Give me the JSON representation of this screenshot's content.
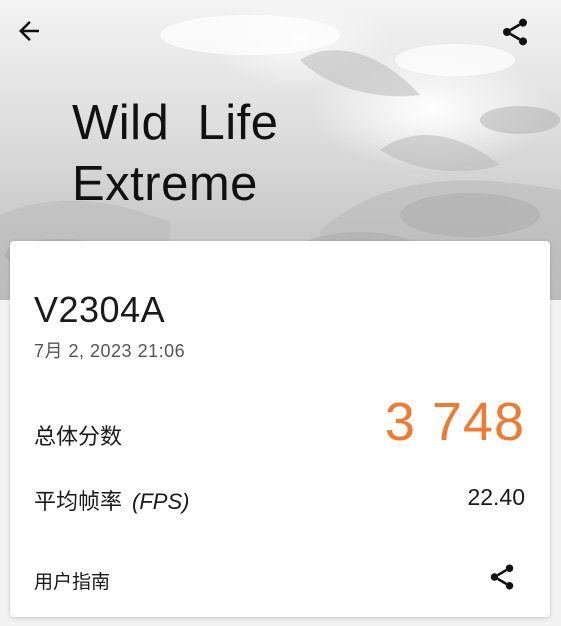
{
  "header": {
    "title": "Wild  Life\nExtreme",
    "back_icon": "arrow-left-icon",
    "share_icon": "share-icon"
  },
  "result": {
    "device_name": "V2304A",
    "date": "7月 2, 2023 21:06",
    "score_label": "总体分数",
    "score_value": "3 748",
    "fps_label": "平均帧率",
    "fps_unit": "(FPS)",
    "fps_value": "22.40",
    "guide_label": "用户指南"
  },
  "colors": {
    "score": "#ef7a30",
    "text": "#1a1a1a",
    "card": "#ffffff"
  }
}
